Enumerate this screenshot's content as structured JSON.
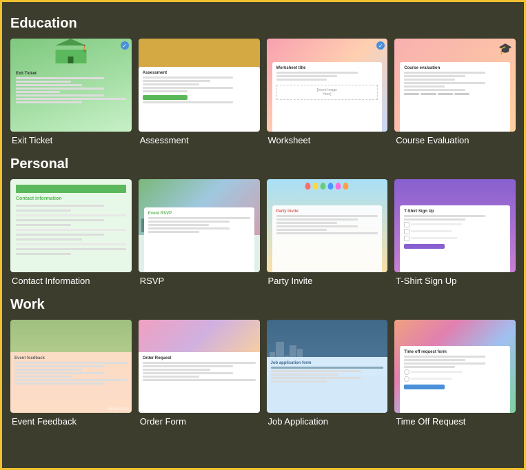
{
  "sections": [
    {
      "id": "education",
      "title": "Education",
      "cards": [
        {
          "id": "exit-ticket",
          "label": "Exit Ticket",
          "thumb": "exit"
        },
        {
          "id": "assessment",
          "label": "Assessment",
          "thumb": "assessment"
        },
        {
          "id": "worksheet",
          "label": "Worksheet",
          "thumb": "worksheet"
        },
        {
          "id": "course-evaluation",
          "label": "Course Evaluation",
          "thumb": "course"
        }
      ]
    },
    {
      "id": "personal",
      "title": "Personal",
      "cards": [
        {
          "id": "contact-information",
          "label": "Contact Information",
          "thumb": "contact"
        },
        {
          "id": "rsvp",
          "label": "RSVP",
          "thumb": "rsvp"
        },
        {
          "id": "party-invite",
          "label": "Party Invite",
          "thumb": "party"
        },
        {
          "id": "tshirt-signup",
          "label": "T-Shirt Sign Up",
          "thumb": "tshirt"
        }
      ]
    },
    {
      "id": "work",
      "title": "Work",
      "cards": [
        {
          "id": "event-feedback",
          "label": "Event Feedback",
          "thumb": "feedback"
        },
        {
          "id": "order-form",
          "label": "Order Form",
          "thumb": "order"
        },
        {
          "id": "job-application",
          "label": "Job Application",
          "thumb": "job"
        },
        {
          "id": "time-off-request",
          "label": "Time Off Request",
          "thumb": "timeoff"
        }
      ]
    }
  ],
  "watermark": "jollege.com"
}
